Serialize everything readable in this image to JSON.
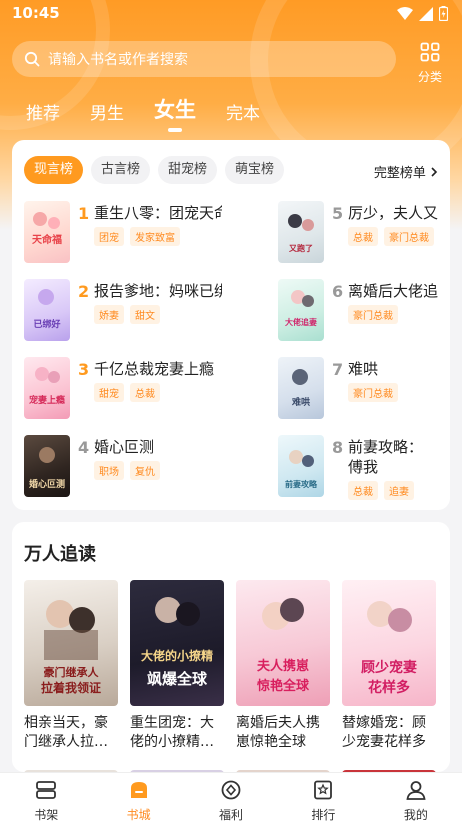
{
  "status": {
    "time": "10:45"
  },
  "search": {
    "placeholder": "请输入书名或作者搜索"
  },
  "category": {
    "label": "分类"
  },
  "tabs": [
    {
      "label": "推荐",
      "active": false
    },
    {
      "label": "男生",
      "active": false
    },
    {
      "label": "女生",
      "active": true
    },
    {
      "label": "完本",
      "active": false
    }
  ],
  "ranking": {
    "chips": [
      "现言榜",
      "古言榜",
      "甜宠榜",
      "萌宝榜"
    ],
    "active_chip": 0,
    "full_list_label": "完整榜单",
    "items": [
      {
        "rank": "1",
        "title": "重生八零：团宠天命福妻",
        "tags": [
          "团宠",
          "发家致富"
        ]
      },
      {
        "rank": "2",
        "title": "报告爹地：妈咪已绑好",
        "tags": [
          "娇妻",
          "甜文"
        ]
      },
      {
        "rank": "3",
        "title": "千亿总裁宠妻上瘾",
        "tags": [
          "甜宠",
          "总裁"
        ]
      },
      {
        "rank": "4",
        "title": "婚心叵测",
        "tags": [
          "职场",
          "复仇"
        ]
      },
      {
        "rank": "5",
        "title": "厉少，夫人又",
        "tags": [
          "总裁",
          "豪门总裁"
        ]
      },
      {
        "rank": "6",
        "title": "离婚后大佬追",
        "tags": [
          "豪门总裁"
        ]
      },
      {
        "rank": "7",
        "title": "难哄",
        "tags": [
          "豪门总裁"
        ]
      },
      {
        "rank": "8",
        "title": "前妻攻略：傅我",
        "tags": [
          "总裁",
          "追妻"
        ]
      }
    ]
  },
  "popular": {
    "title": "万人追读",
    "books": [
      {
        "name": "相亲当天，豪门继承人拉…"
      },
      {
        "name": "重生团宠：大佬的小撩精…"
      },
      {
        "name": "离婚后夫人携崽惊艳全球"
      },
      {
        "name": "替嫁婚宠：顾少宠妻花样多"
      }
    ]
  },
  "bottom_nav": [
    {
      "label": "书架",
      "icon": "bookshelf-icon",
      "active": false
    },
    {
      "label": "书城",
      "icon": "bookstore-icon",
      "active": true
    },
    {
      "label": "福利",
      "icon": "welfare-icon",
      "active": false
    },
    {
      "label": "排行",
      "icon": "ranking-icon",
      "active": false
    },
    {
      "label": "我的",
      "icon": "profile-icon",
      "active": false
    }
  ],
  "colors": {
    "accent": "#ff9a1f",
    "tag_bg": "#fff2e3",
    "tag_text": "#ff8a1f"
  }
}
